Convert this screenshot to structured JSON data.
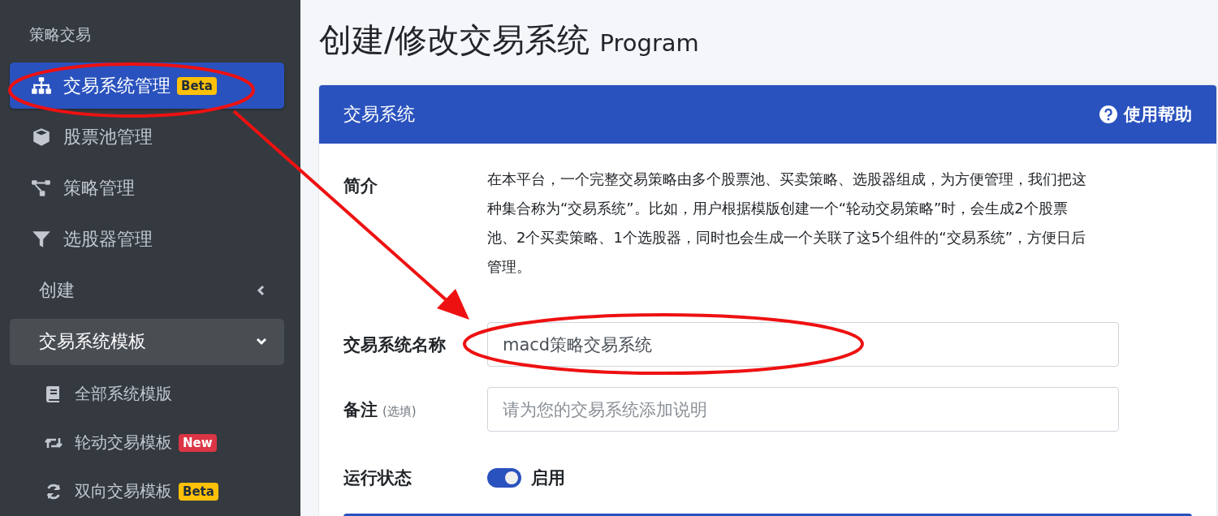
{
  "sidebar": {
    "header": "策略交易",
    "items": [
      {
        "label": "交易系统管理",
        "badge": {
          "text": "Beta",
          "kind": "warning"
        },
        "selected": true
      },
      {
        "label": "股票池管理",
        "selected": false
      },
      {
        "label": "策略管理",
        "selected": false
      },
      {
        "label": "选股器管理",
        "selected": false
      }
    ],
    "groups": [
      {
        "label": "创建",
        "expanded": false
      },
      {
        "label": "交易系统模板",
        "expanded": true,
        "children": [
          {
            "label": "全部系统模版"
          },
          {
            "label": "轮动交易模板",
            "badge": {
              "text": "New",
              "kind": "danger"
            }
          },
          {
            "label": "双向交易模板",
            "badge": {
              "text": "Beta",
              "kind": "warning"
            }
          }
        ]
      }
    ]
  },
  "page": {
    "title": "创建/修改交易系统",
    "subtitle": "Program"
  },
  "card": {
    "title": "交易系统",
    "help": "使用帮助",
    "intro": {
      "label": "简介",
      "text": "在本平台，一个完整交易策略由多个股票池、买卖策略、选股器组成，为方便管理，我们把这种集合称为“交易系统”。比如，用户根据模版创建一个“轮动交易策略”时，会生成2个股票池、2个买卖策略、1个选股器，同时也会生成一个关联了这5个组件的“交易系统”，方便日后管理。"
    },
    "fields": [
      {
        "kind": "text",
        "label": "交易系统名称",
        "value": "macd策略交易系统"
      },
      {
        "kind": "text",
        "label": "备注",
        "hint": "(选填)",
        "placeholder": "请为您的交易系统添加说明"
      },
      {
        "kind": "switch",
        "label": "运行状态",
        "on": true,
        "value": "启用"
      }
    ]
  },
  "annotations": [
    {
      "kind": "ellipse"
    },
    {
      "kind": "ellipse"
    },
    {
      "kind": "arrow"
    }
  ]
}
